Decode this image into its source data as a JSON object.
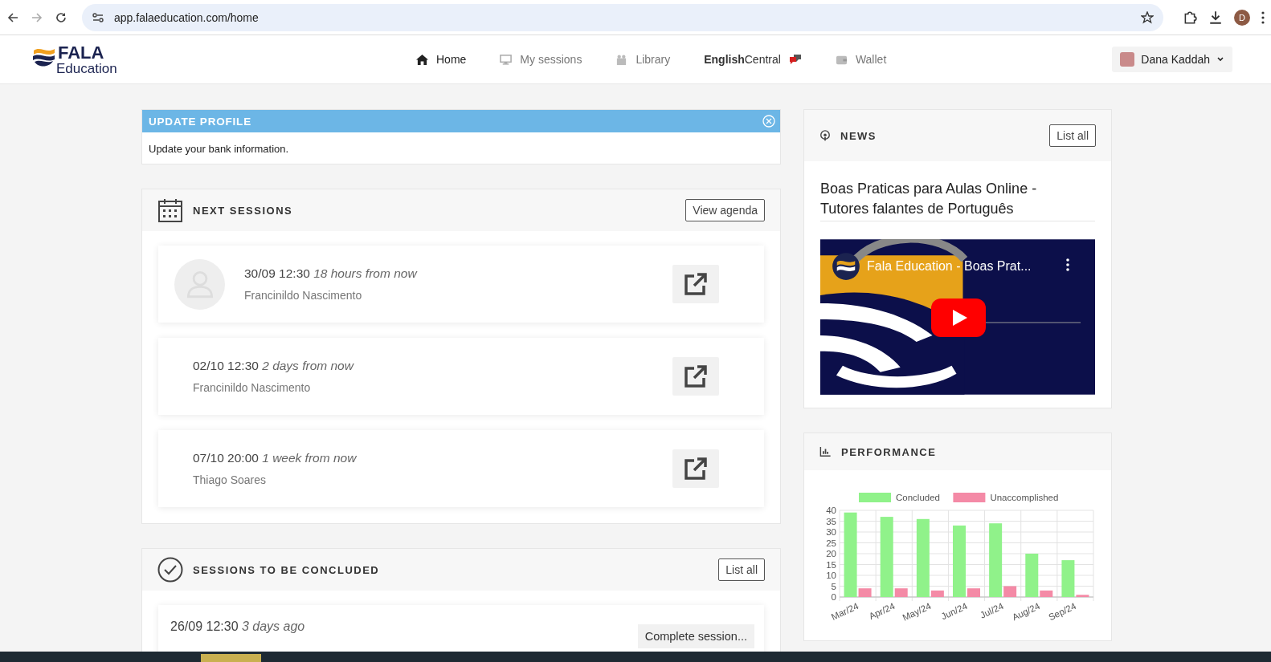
{
  "browser": {
    "url": "app.falaeducation.com/home",
    "profile_initial": "D"
  },
  "header": {
    "logo_title": "FALA",
    "logo_subtitle": "Education",
    "nav": [
      {
        "label": "Home",
        "selected": true
      },
      {
        "label": "My sessions",
        "selected": false
      },
      {
        "label": "Library",
        "selected": false
      },
      {
        "label": "**English**Central",
        "selected": false
      },
      {
        "label": "Wallet",
        "selected": false
      }
    ],
    "user": "Dana Kaddah"
  },
  "update_profile": {
    "title": "UPDATE PROFILE",
    "message": "Update your bank information."
  },
  "next_sessions": {
    "title": "NEXT SESSIONS",
    "button": "View agenda",
    "items": [
      {
        "when": "30/09 12:30",
        "relative": "18 hours from now",
        "tutor": "Francinildo Nascimento",
        "avatar": true
      },
      {
        "when": "02/10 12:30",
        "relative": "2 days from now",
        "tutor": "Francinildo Nascimento",
        "avatar": false
      },
      {
        "when": "07/10 20:00",
        "relative": "1 week from now",
        "tutor": "Thiago Soares",
        "avatar": false
      }
    ]
  },
  "to_conclude": {
    "title": "SESSIONS TO BE CONCLUDED",
    "button": "List all",
    "items": [
      {
        "when": "26/09 12:30",
        "relative": "3 days ago",
        "action": "Complete session..."
      }
    ]
  },
  "news": {
    "title": "NEWS",
    "button": "List all",
    "headline": "Boas Praticas para Aulas Online - Tutores falantes de Português",
    "video": {
      "kind": "picture",
      "title": "Fala Education - Boas Prat..."
    }
  },
  "performance": {
    "title": "PERFORMANCE",
    "chart_data": {
      "type": "bar",
      "categories": [
        "Mar/24",
        "Apr/24",
        "May/24",
        "Jun/24",
        "Jul/24",
        "Aug/24",
        "Sep/24"
      ],
      "series": [
        {
          "name": "Concluded",
          "color": "#90f28a",
          "values": [
            39,
            37,
            36,
            33,
            34,
            20,
            17
          ]
        },
        {
          "name": "Unaccomplished",
          "color": "#f48aa6",
          "values": [
            4,
            4,
            3,
            4,
            5,
            3,
            1
          ]
        }
      ],
      "grid": true,
      "legend": true,
      "ylim": [
        0,
        40
      ],
      "yticks": [
        0,
        5,
        10,
        15,
        20,
        25,
        30,
        35,
        40
      ]
    }
  }
}
